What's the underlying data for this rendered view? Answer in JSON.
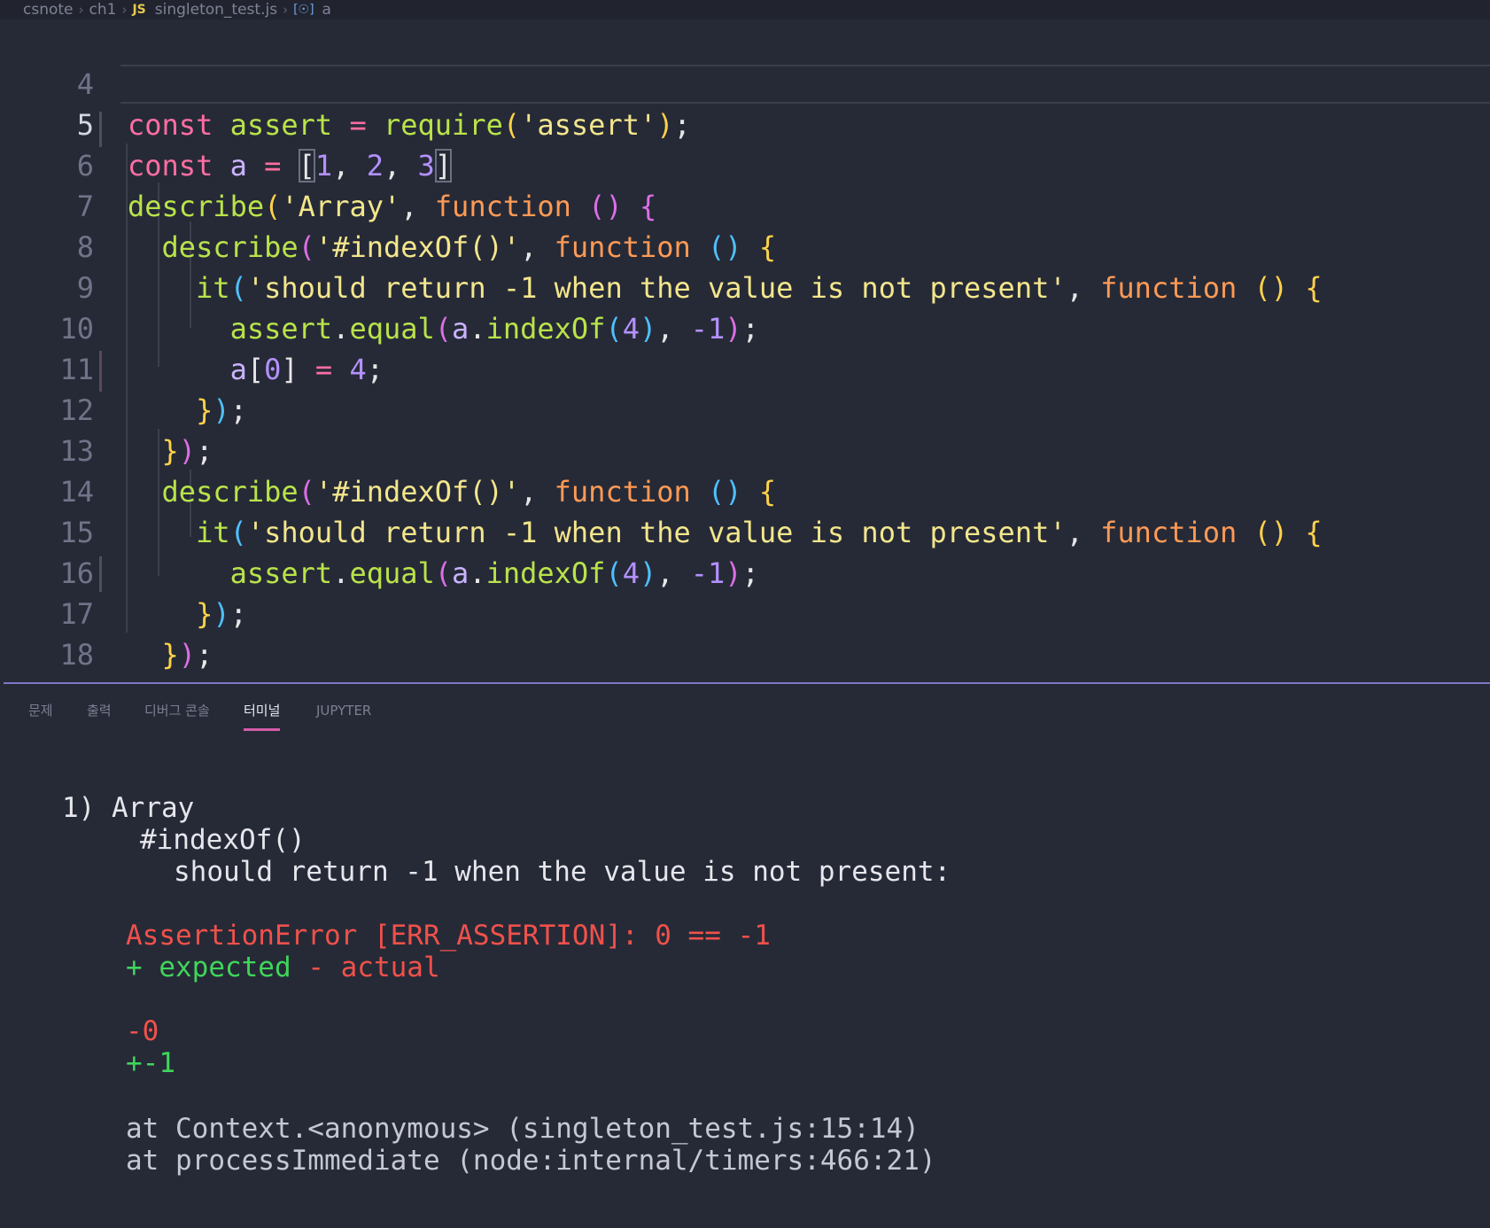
{
  "breadcrumb": {
    "items": [
      "csnote",
      "ch1",
      "singleton_test.js",
      "a"
    ],
    "file_lang_badge": "JS",
    "symbol_badge": "[☉]"
  },
  "editor": {
    "lines": [
      {
        "n": "4"
      },
      {
        "n": "5"
      },
      {
        "n": "6"
      },
      {
        "n": "7"
      },
      {
        "n": "8"
      },
      {
        "n": "9"
      },
      {
        "n": "10"
      },
      {
        "n": "11"
      },
      {
        "n": "12"
      },
      {
        "n": "13"
      },
      {
        "n": "14"
      },
      {
        "n": "15"
      },
      {
        "n": "16"
      },
      {
        "n": "17"
      },
      {
        "n": "18"
      }
    ],
    "tokens": {
      "const": "const",
      "assert": "assert",
      "eq": "=",
      "require": "require",
      "assert_str": "'assert'",
      "a": "a",
      "n1": "1",
      "n2": "2",
      "n3": "3",
      "describe": "describe",
      "array_str": "'Array'",
      "function": "function",
      "indexOf_str": "'#indexOf()'",
      "it": "it",
      "should_str": "'should return -1 when the value is not present'",
      "equal": "equal",
      "indexOf": "indexOf",
      "n4": "4",
      "neg1": "-1",
      "n0": "0"
    }
  },
  "panel": {
    "tabs": [
      "문제",
      "출력",
      "디버그 콘솔",
      "터미널",
      "JUPYTER"
    ],
    "active_tab": "터미널",
    "terminal": [
      "1) Array",
      "#indexOf()",
      "should return -1 when the value is not present:",
      "AssertionError [ERR_ASSERTION]: 0 == -1",
      "+ expected",
      "- actual",
      "-0",
      "+-1",
      "at Context.<anonymous> (singleton_test.js:15:14)",
      "at processImmediate (node:internal/timers:466:21)"
    ]
  },
  "colors": {
    "background": "#262a37",
    "keyword": "#ff6ea2",
    "function_name": "#b9e34a",
    "string": "#f3e68c",
    "number": "#b491ff",
    "error": "#f0514b",
    "expected": "#3fd65a",
    "active_tab_underline": "#d45ba8"
  }
}
